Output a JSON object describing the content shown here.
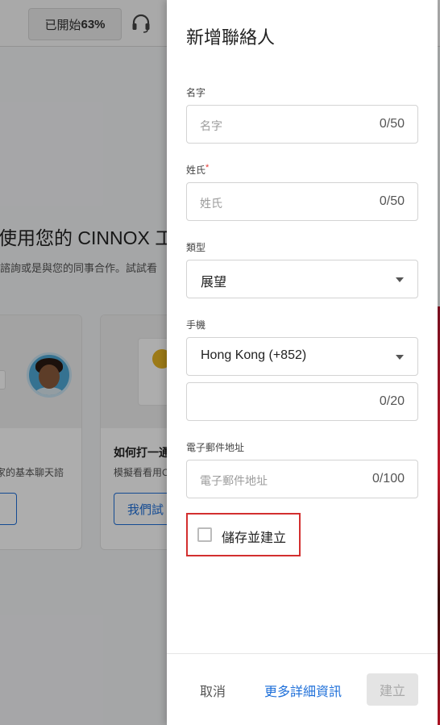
{
  "background": {
    "progress_label": "已開始",
    "progress_value": "63%",
    "heading": "使用您的 CINNOX 工",
    "subtext": "諮詢或是與您的同事合作。試試看",
    "cards": [
      {
        "title": "",
        "text": "家的基本聊天諮",
        "button": ""
      },
      {
        "title": "如何打一通",
        "text": "模擬看看用C",
        "button": "我們試"
      }
    ],
    "icons": {
      "support": "headset-icon"
    }
  },
  "drawer": {
    "title": "新增聯絡人",
    "first_name": {
      "label": "名字",
      "placeholder": "名字",
      "counter": "0/50"
    },
    "last_name": {
      "label": "姓氏",
      "required_mark": "*",
      "placeholder": "姓氏",
      "counter": "0/50"
    },
    "type": {
      "label": "類型",
      "value": "展望"
    },
    "mobile": {
      "label": "手機",
      "country": "Hong Kong (+852)",
      "counter": "0/20"
    },
    "email": {
      "label": "電子郵件地址",
      "placeholder": "電子郵件地址",
      "counter": "0/100"
    },
    "save_checkbox": {
      "label": "儲存並建立",
      "checked": false
    },
    "footer": {
      "cancel": "取消",
      "more_details": "更多詳細資訊",
      "create": "建立"
    }
  },
  "colors": {
    "accent": "#1e6fd9",
    "highlight_box": "#d32f2f",
    "required": "#e53935"
  }
}
